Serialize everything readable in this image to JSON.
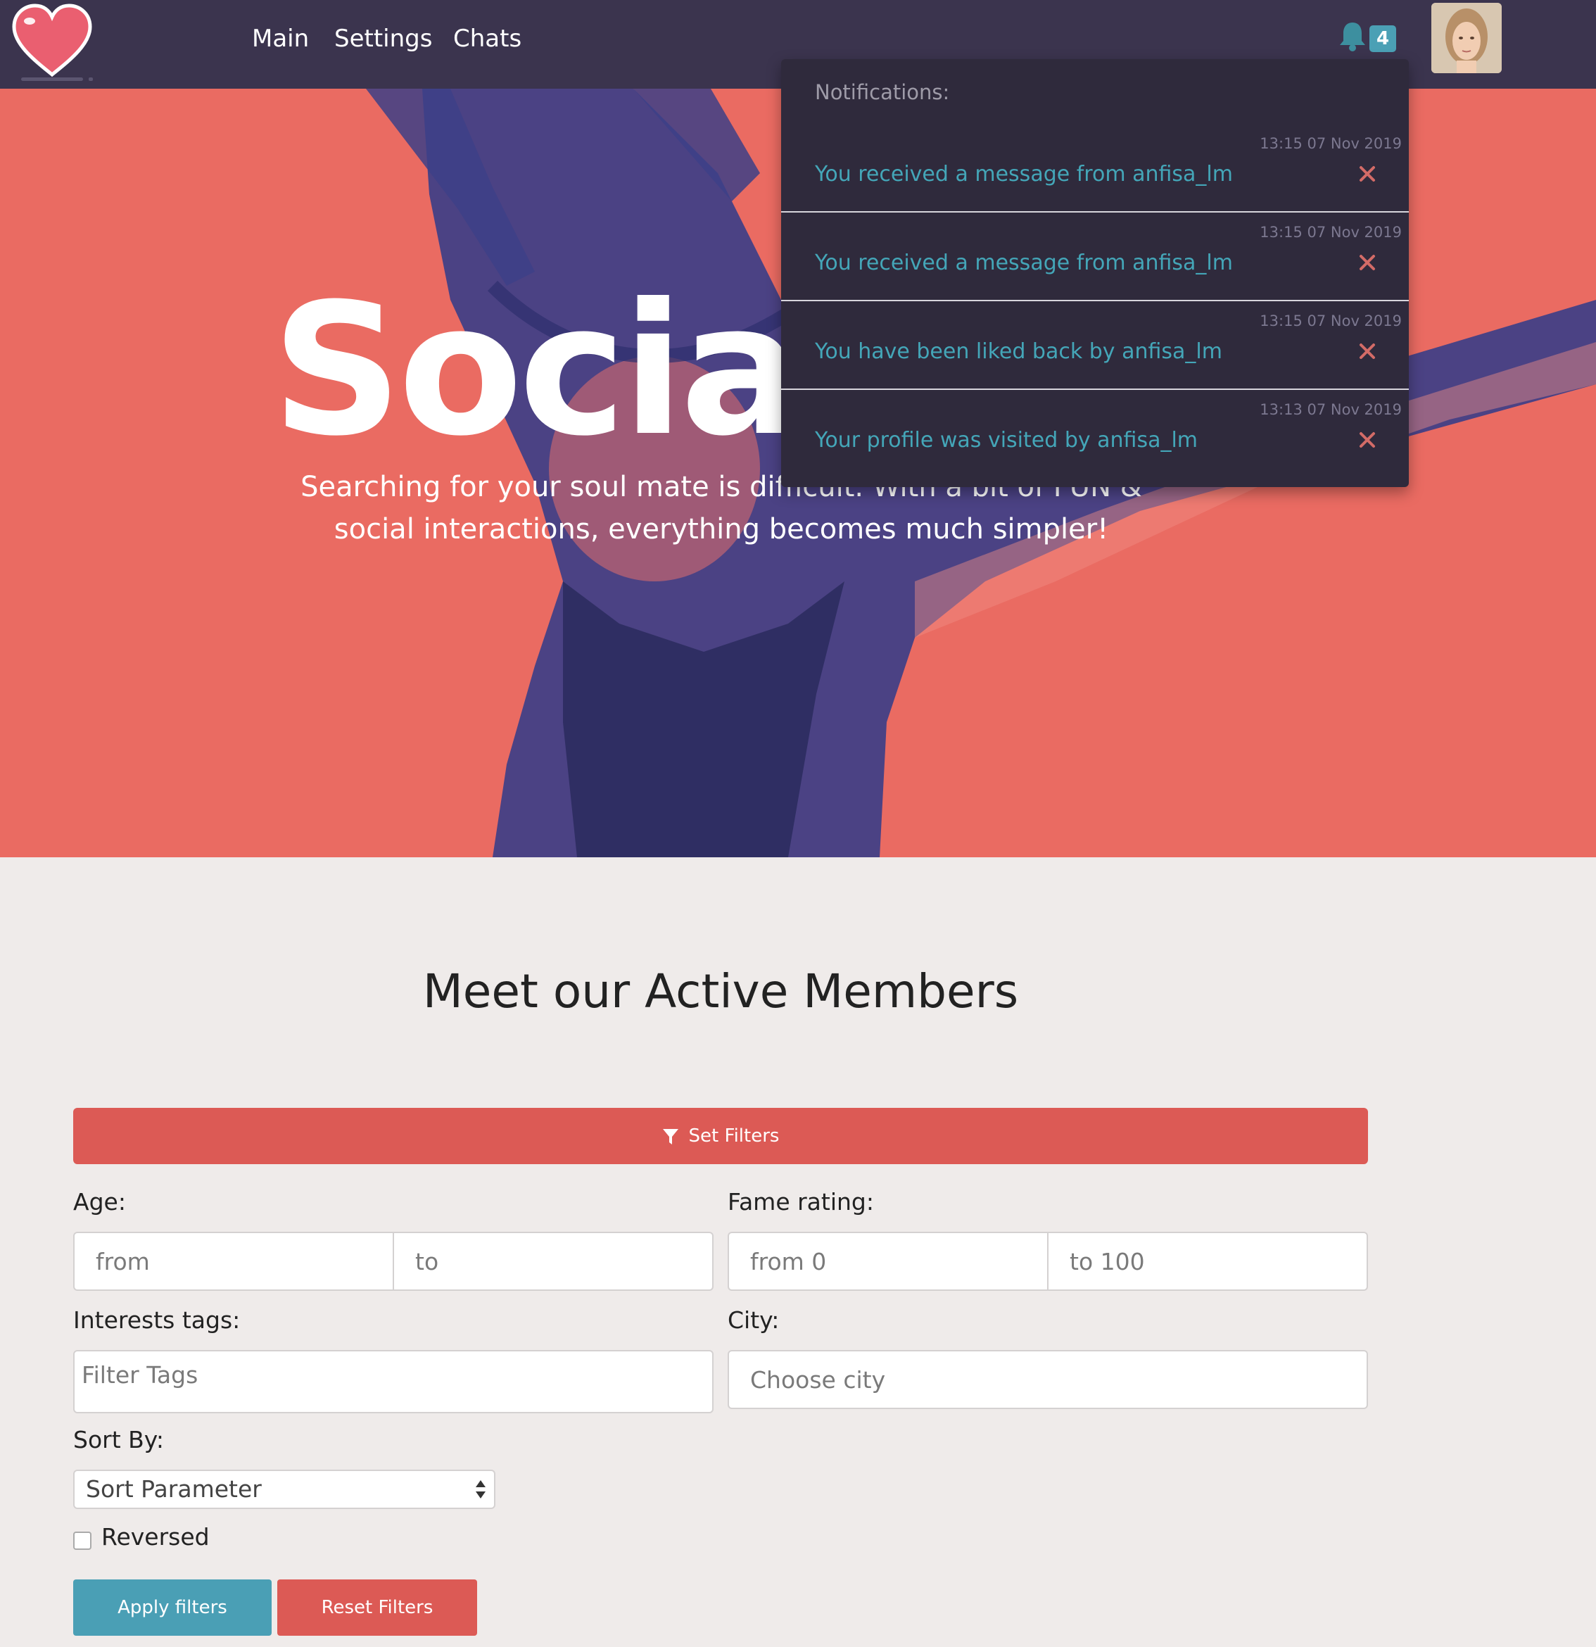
{
  "nav": {
    "links": [
      "Main",
      "Settings",
      "Chats"
    ],
    "notification_count": "4",
    "colors": {
      "bar": "#3b344e",
      "badge": "#4ba0b5"
    }
  },
  "hero": {
    "title": "Socia",
    "subtitle": "Searching for your soul mate is difficult. With a bit of FUN & social interactions, everything becomes much simpler!",
    "colors": {
      "background": "#ea6b62",
      "overlay": "#3d3f87"
    }
  },
  "notifications": {
    "header": "Notifications:",
    "items": [
      {
        "time": "13:15 07 Nov 2019",
        "text": "You received a message from anfisa_lm"
      },
      {
        "time": "13:15 07 Nov 2019",
        "text": "You received a message from anfisa_lm"
      },
      {
        "time": "13:15 07 Nov 2019",
        "text": "You have been liked back by anfisa_lm"
      },
      {
        "time": "13:13 07 Nov 2019",
        "text": "Your profile was visited by anfisa_lm"
      }
    ]
  },
  "members": {
    "title": "Meet our Active Members",
    "set_filters_label": "Set Filters",
    "age_label": "Age:",
    "age_from_placeholder": "from",
    "age_to_placeholder": "to",
    "fame_label": "Fame rating:",
    "fame_from_placeholder": "from 0",
    "fame_to_placeholder": "to 100",
    "tags_label": "Interests tags:",
    "tags_placeholder": "Filter Tags",
    "city_label": "City:",
    "city_placeholder": "Choose city",
    "sort_label": "Sort By:",
    "sort_value": "Sort Parameter",
    "reversed_label": "Reversed",
    "apply_label": "Apply filters",
    "reset_label": "Reset Filters",
    "colors": {
      "primary": "#dc5a55",
      "apply": "#4a9fb5"
    }
  }
}
